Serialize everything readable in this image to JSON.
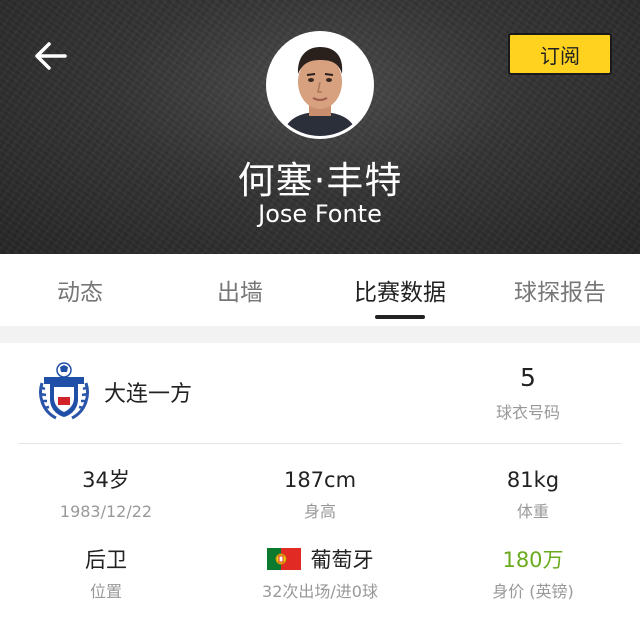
{
  "header": {
    "subscribe_label": "订阅",
    "player_name_cn": "何塞·丰特",
    "player_name_en": "Jose Fonte",
    "back_icon": "arrow-left-icon"
  },
  "tabs": [
    {
      "label": "动态",
      "active": false
    },
    {
      "label": "出墙",
      "active": false
    },
    {
      "label": "比赛数据",
      "active": true
    },
    {
      "label": "球探报告",
      "active": false
    }
  ],
  "club": {
    "name": "大连一方",
    "logo_icon": "club-crest-icon",
    "jersey_number": "5",
    "jersey_label": "球衣号码"
  },
  "stats": {
    "age": {
      "value": "34岁",
      "label": "1983/12/22"
    },
    "height": {
      "value": "187cm",
      "label": "身高"
    },
    "weight": {
      "value": "81kg",
      "label": "体重"
    },
    "position": {
      "value": "后卫",
      "label": "位置"
    },
    "nationality": {
      "value": "葡萄牙",
      "label": "32次出场/进0球",
      "flag_icon": "portugal-flag-icon"
    },
    "market_value": {
      "value": "180万",
      "label": "身价 (英镑)"
    }
  },
  "colors": {
    "accent_yellow": "#ffd21f",
    "value_green": "#6aab1e",
    "header_bg": "#2f2f2f"
  }
}
